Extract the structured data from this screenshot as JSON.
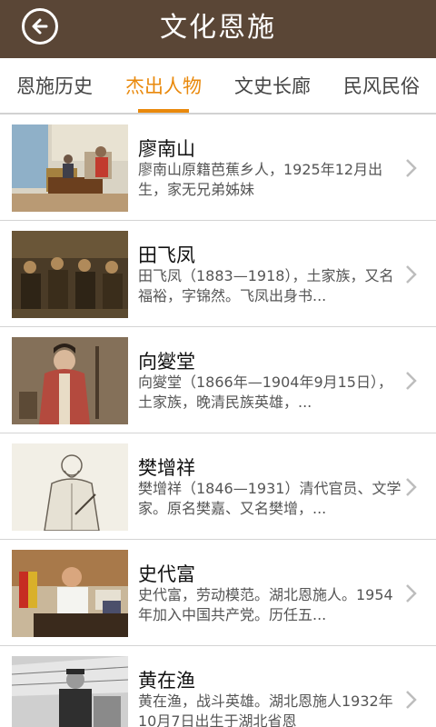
{
  "header": {
    "title": "文化恩施",
    "back_icon": "back-arrow-icon"
  },
  "tabs": [
    {
      "label": "恩施历史",
      "active": false
    },
    {
      "label": "杰出人物",
      "active": true
    },
    {
      "label": "文史长廊",
      "active": false
    },
    {
      "label": "民风民俗",
      "active": false
    }
  ],
  "colors": {
    "header_bg": "#5a4636",
    "accent": "#e9890c"
  },
  "list": [
    {
      "name": "廖南山",
      "desc": "廖南山原籍芭蕉乡人，1925年12月出生，家无兄弟姊妹"
    },
    {
      "name": "田飞凤",
      "desc": "田飞凤（1883—1918），土家族，又名福裕，字锦然。飞凤出身书..."
    },
    {
      "name": "向夑堂",
      "desc": "向夑堂（1866年—1904年9月15日），土家族，晚清民族英雄，..."
    },
    {
      "name": "樊增祥",
      "desc": "樊增祥（1846—1931）清代官员、文学家。原名樊嘉、又名樊增，..."
    },
    {
      "name": "史代富",
      "desc": "史代富，劳动模范。湖北恩施人。1954年加入中国共产党。历任五..."
    },
    {
      "name": "黄在渔",
      "desc": "黄在渔，战斗英雄。湖北恩施人1932年10月7日出生于湖北省恩"
    }
  ]
}
